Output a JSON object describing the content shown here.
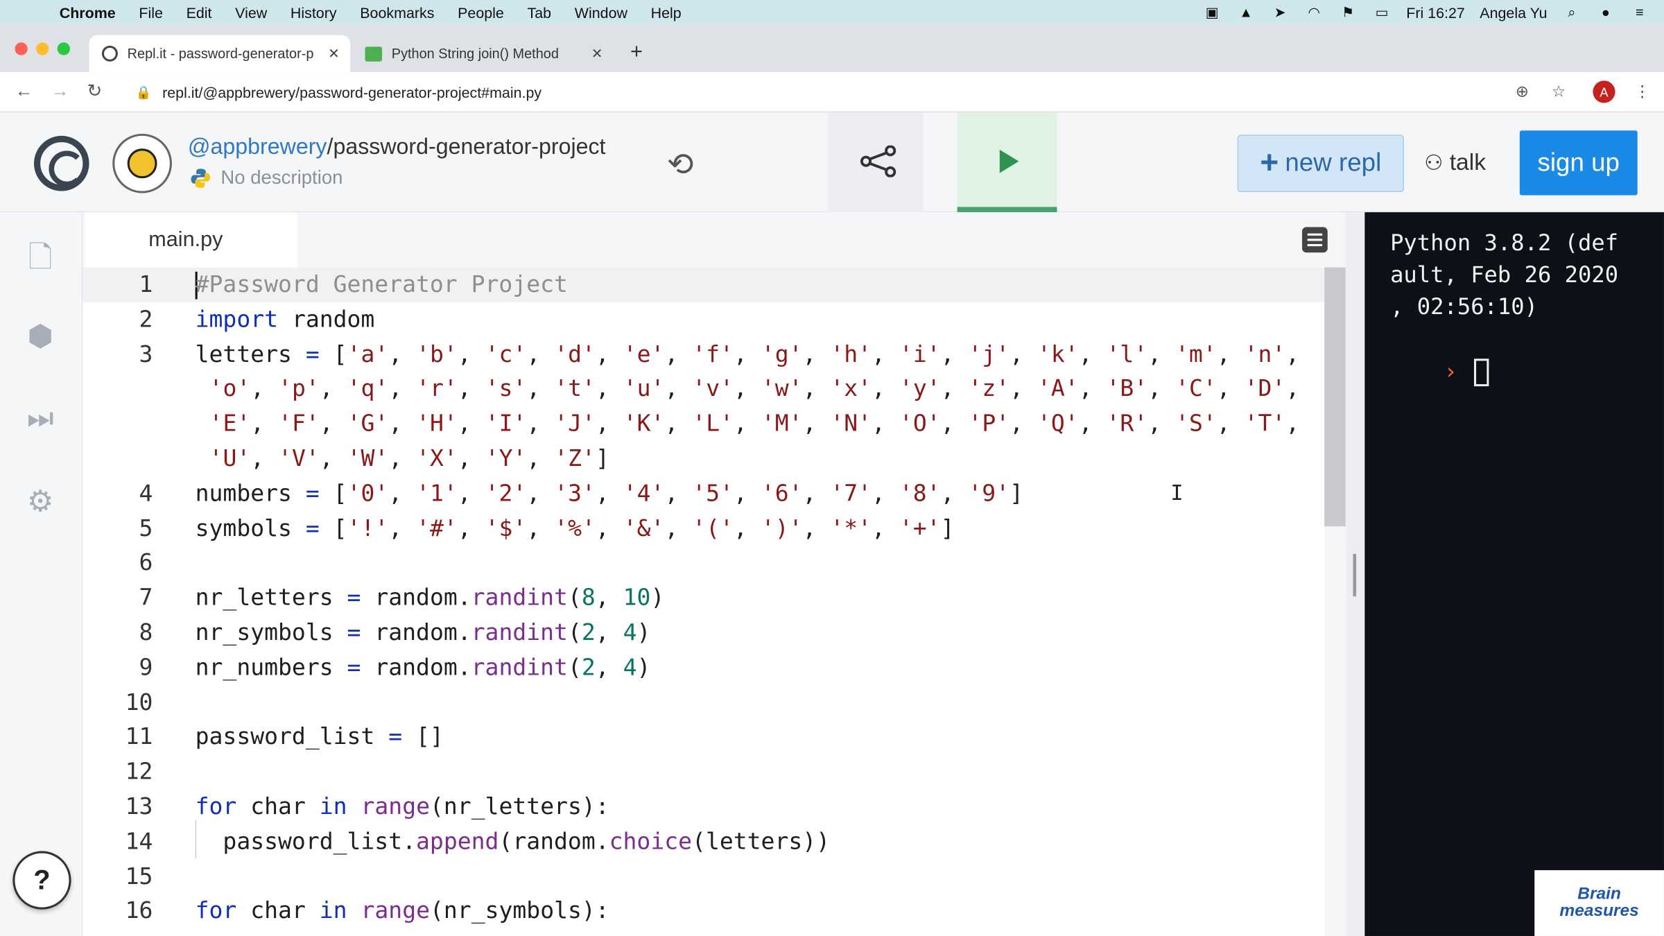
{
  "menubar": {
    "app": "Chrome",
    "items": [
      "File",
      "Edit",
      "View",
      "History",
      "Bookmarks",
      "People",
      "Tab",
      "Window",
      "Help"
    ],
    "clock": "Fri 16:27",
    "user": "Angela Yu"
  },
  "browser": {
    "tabs": [
      {
        "title": "Repl.it - password-generator-p"
      },
      {
        "title": "Python String join() Method"
      }
    ],
    "url": "repl.it/@appbrewery/password-generator-project#main.py",
    "profile_initial": "A"
  },
  "repl": {
    "owner": "@appbrewery",
    "slash": "/",
    "project": "password-generator-project",
    "description": "No description",
    "new_repl": "new repl",
    "talk": "talk",
    "sign_up": "sign up"
  },
  "editor": {
    "filename": "main.py",
    "lines": [
      {
        "n": "1",
        "html": "<span class='caret'></span><span class='cm'>#Password Generator Project</span>"
      },
      {
        "n": "2",
        "html": "<span class='kw'>import</span> random"
      },
      {
        "n": "3",
        "html": "letters <span class='op'>=</span> [<span class='str'>'a'</span>, <span class='str'>'b'</span>, <span class='str'>'c'</span>, <span class='str'>'d'</span>, <span class='str'>'e'</span>, <span class='str'>'f'</span>, <span class='str'>'g'</span>, <span class='str'>'h'</span>, <span class='str'>'i'</span>, <span class='str'>'j'</span>, <span class='str'>'k'</span>, <span class='str'>'l'</span>, <span class='str'>'m'</span>, <span class='str'>'n'</span>,"
      },
      {
        "n": "",
        "html": " <span class='str'>'o'</span>, <span class='str'>'p'</span>, <span class='str'>'q'</span>, <span class='str'>'r'</span>, <span class='str'>'s'</span>, <span class='str'>'t'</span>, <span class='str'>'u'</span>, <span class='str'>'v'</span>, <span class='str'>'w'</span>, <span class='str'>'x'</span>, <span class='str'>'y'</span>, <span class='str'>'z'</span>, <span class='str'>'A'</span>, <span class='str'>'B'</span>, <span class='str'>'C'</span>, <span class='str'>'D'</span>,"
      },
      {
        "n": "",
        "html": " <span class='str'>'E'</span>, <span class='str'>'F'</span>, <span class='str'>'G'</span>, <span class='str'>'H'</span>, <span class='str'>'I'</span>, <span class='str'>'J'</span>, <span class='str'>'K'</span>, <span class='str'>'L'</span>, <span class='str'>'M'</span>, <span class='str'>'N'</span>, <span class='str'>'O'</span>, <span class='str'>'P'</span>, <span class='str'>'Q'</span>, <span class='str'>'R'</span>, <span class='str'>'S'</span>, <span class='str'>'T'</span>,"
      },
      {
        "n": "",
        "html": " <span class='str'>'U'</span>, <span class='str'>'V'</span>, <span class='str'>'W'</span>, <span class='str'>'X'</span>, <span class='str'>'Y'</span>, <span class='str'>'Z'</span>]"
      },
      {
        "n": "4",
        "html": "numbers <span class='op'>=</span> [<span class='str'>'0'</span>, <span class='str'>'1'</span>, <span class='str'>'2'</span>, <span class='str'>'3'</span>, <span class='str'>'4'</span>, <span class='str'>'5'</span>, <span class='str'>'6'</span>, <span class='str'>'7'</span>, <span class='str'>'8'</span>, <span class='str'>'9'</span>]"
      },
      {
        "n": "5",
        "html": "symbols <span class='op'>=</span> [<span class='str'>'!'</span>, <span class='str'>'#'</span>, <span class='str'>'$'</span>, <span class='str'>'%'</span>, <span class='str'>'&amp;'</span>, <span class='str'>'('</span>, <span class='str'>')'</span>, <span class='str'>'*'</span>, <span class='str'>'+'</span>]"
      },
      {
        "n": "6",
        "html": ""
      },
      {
        "n": "7",
        "html": "nr_letters <span class='op'>=</span> random.<span class='fn'>randint</span>(<span class='num'>8</span>, <span class='num'>10</span>)"
      },
      {
        "n": "8",
        "html": "nr_symbols <span class='op'>=</span> random.<span class='fn'>randint</span>(<span class='num'>2</span>, <span class='num'>4</span>)"
      },
      {
        "n": "9",
        "html": "nr_numbers <span class='op'>=</span> random.<span class='fn'>randint</span>(<span class='num'>2</span>, <span class='num'>4</span>)"
      },
      {
        "n": "10",
        "html": ""
      },
      {
        "n": "11",
        "html": "password_list <span class='op'>=</span> []"
      },
      {
        "n": "12",
        "html": ""
      },
      {
        "n": "13",
        "html": "<span class='kw'>for</span> char <span class='kw'>in</span> <span class='fn'>range</span>(nr_letters):"
      },
      {
        "n": "14",
        "html": "  password_list.<span class='fn'>append</span>(random.<span class='fn'>choice</span>(letters))"
      },
      {
        "n": "15",
        "html": ""
      },
      {
        "n": "16",
        "html": "<span class='kw'>for</span> char <span class='kw'>in</span> <span class='fn'>range</span>(nr_symbols):"
      }
    ]
  },
  "console": {
    "lines": [
      "Python 3.8.2 (def",
      "ault, Feb 26 2020",
      ", 02:56:10)"
    ],
    "prompt": "›"
  },
  "watermark": {
    "line1": "Brain",
    "line2": "measures"
  }
}
